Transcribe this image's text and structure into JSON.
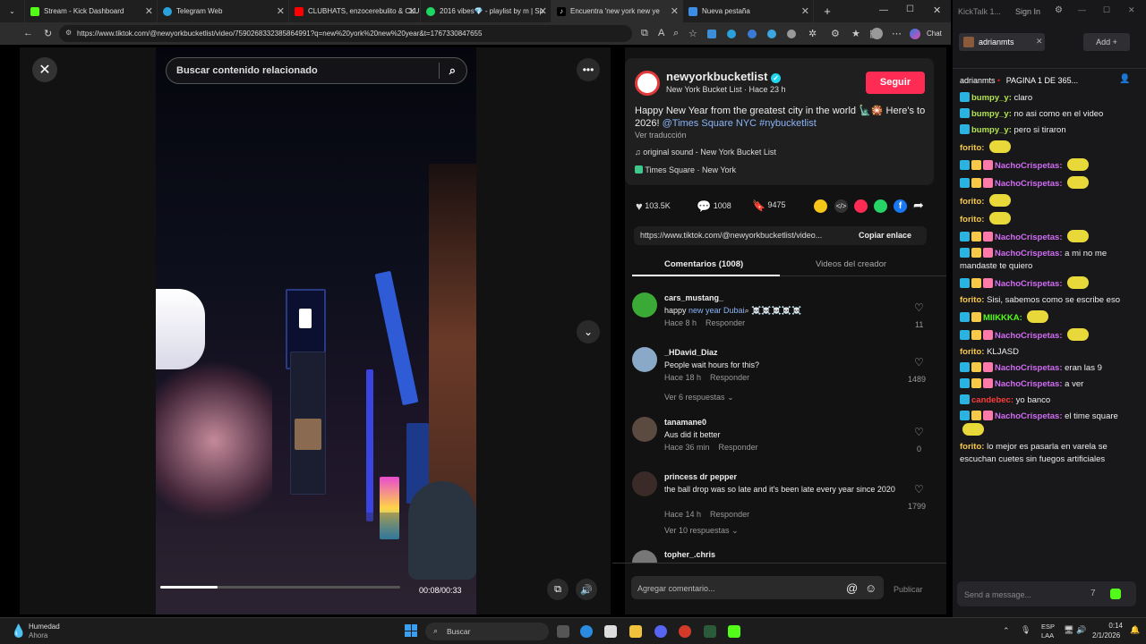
{
  "tabs": [
    {
      "label": "Stream - Kick Dashboard",
      "color": "#53fc18"
    },
    {
      "label": "Telegram Web",
      "color": "#2aa1da"
    },
    {
      "label": "CLUBHATS, enzocerebulito & CLU",
      "color": "#ff0000"
    },
    {
      "label": "2016 vibes💎 - playlist by m | Sp",
      "color": "#1ed760"
    },
    {
      "label": "Encuentra 'new york new ye",
      "color": "#ffffff"
    },
    {
      "label": "Nueva pestaña",
      "color": "#3a8ee6"
    }
  ],
  "address": {
    "url": "https://www.tiktok.com/@newyorkbucketlist/video/7590268332385864991?q=new%20york%20new%20year&t=1767330847655",
    "chat_label": "Chat"
  },
  "video": {
    "search_placeholder": "Buscar contenido relacionado",
    "time": "00:08/00:33",
    "progress": 0.24
  },
  "post": {
    "username": "newyorkbucketlist",
    "subtitle": "New York Bucket List · Hace 23 h",
    "follow": "Seguir",
    "caption": "Happy New Year from the greatest city in the world 🗽🎇 Here's to 2026!",
    "mention": "@Times Square NYC",
    "hashtag": "#nybucketlist",
    "translate": "Ver traducción",
    "sound": "original sound - New York Bucket List",
    "location": "Times Square · New York",
    "likes": "103.5K",
    "comments": "1008",
    "saves": "9475",
    "link": "https://www.tiktok.com/@newyorkbucketlist/video...",
    "copy": "Copiar enlace"
  },
  "tabs2": {
    "comments": "Comentarios (1008)",
    "creator": "Videos del creador"
  },
  "comments": [
    {
      "user": "cars_mustang_",
      "text_a": "happy ",
      "text_b": "new year Dubai",
      "text_c": "⌕ ☠️☠️☠️☠️☠️",
      "time": "Hace 8 h",
      "reply": "Responder",
      "likes": "11",
      "color": "#3aa935"
    },
    {
      "user": "_HDavid_Diaz",
      "text": "People wait hours for this?",
      "time": "Hace 18 h",
      "reply": "Responder",
      "likes": "1489",
      "more": "Ver 6 respuestas",
      "color": "#8aa8c8"
    },
    {
      "user": "tanamane0",
      "text": "Aus did it better",
      "time": "Hace 36 min",
      "reply": "Responder",
      "likes": "0",
      "color": "#5a4a40"
    },
    {
      "user": "princess dr pepper",
      "text": "the ball drop was so late and it's been late every year since 2020",
      "time": "Hace 14 h",
      "reply": "Responder",
      "likes": "1799",
      "more": "Ver 10 respuestas",
      "color": "#3a2a28"
    },
    {
      "user": "topher_.chris",
      "color": "#777"
    }
  ],
  "comment_input": {
    "placeholder": "Agregar comentario...",
    "publish": "Publicar"
  },
  "kick": {
    "app": "KickTalk 1...",
    "signin": "Sign In",
    "channel": "adrianmts",
    "add": "Add",
    "header_user": "adrianmts",
    "page": "PAGINA 1 DE 365...",
    "send_placeholder": "Send a message..."
  },
  "chat": [
    {
      "user": "bumpy_y:",
      "msg": "claro",
      "ucolor": "#b4e34c",
      "badges": 1
    },
    {
      "user": "bumpy_y:",
      "msg": "no asi como en el video",
      "ucolor": "#b4e34c",
      "badges": 1
    },
    {
      "user": "bumpy_y:",
      "msg": "pero si tiraron",
      "ucolor": "#b4e34c",
      "badges": 1
    },
    {
      "user": "forito:",
      "msg": "",
      "ucolor": "#f7c948",
      "badges": 0,
      "emote": true
    },
    {
      "user": "NachoCrispetas:",
      "msg": "",
      "ucolor": "#d16cf2",
      "badges": 3,
      "emote": true
    },
    {
      "user": "NachoCrispetas:",
      "msg": "",
      "ucolor": "#d16cf2",
      "badges": 3,
      "emote": true
    },
    {
      "user": "forito:",
      "msg": "",
      "ucolor": "#f7c948",
      "badges": 0,
      "emote": true
    },
    {
      "user": "forito:",
      "msg": "",
      "ucolor": "#f7c948",
      "badges": 0,
      "emote": true
    },
    {
      "user": "NachoCrispetas:",
      "msg": "",
      "ucolor": "#d16cf2",
      "badges": 3,
      "emote": true
    },
    {
      "user": "NachoCrispetas:",
      "msg": "a mi no me mandaste te quiero",
      "ucolor": "#d16cf2",
      "badges": 3
    },
    {
      "user": "NachoCrispetas:",
      "msg": "",
      "ucolor": "#d16cf2",
      "badges": 3,
      "emote": true
    },
    {
      "user": "forito:",
      "msg": "Sisi, sabemos como se escribe eso",
      "ucolor": "#f7c948",
      "badges": 0
    },
    {
      "user": "MIIKKKA:",
      "msg": "",
      "ucolor": "#53fc18",
      "badges": 2,
      "emote": true
    },
    {
      "user": "NachoCrispetas:",
      "msg": "",
      "ucolor": "#d16cf2",
      "badges": 3,
      "emote": true
    },
    {
      "user": "forito:",
      "msg": "KLJASD",
      "ucolor": "#f7c948",
      "badges": 0
    },
    {
      "user": "NachoCrispetas:",
      "msg": "eran las 9",
      "ucolor": "#d16cf2",
      "badges": 3
    },
    {
      "user": "NachoCrispetas:",
      "msg": "a ver",
      "ucolor": "#d16cf2",
      "badges": 3
    },
    {
      "user": "candebec:",
      "msg": "yo banco",
      "ucolor": "#ff3b3b",
      "badges": 1
    },
    {
      "user": "NachoCrispetas:",
      "msg": "el time square",
      "ucolor": "#d16cf2",
      "badges": 3,
      "emote": true
    },
    {
      "user": "forito:",
      "msg": "lo mejor es pasarla en varela se escuchan cuetes sin fuegos artificiales",
      "ucolor": "#f7c948",
      "badges": 0
    }
  ],
  "taskbar": {
    "weather_title": "Humedad",
    "weather_sub": "Ahora",
    "search": "Buscar",
    "lang1": "ESP",
    "lang2": "LAA",
    "time": "0:14",
    "date": "2/1/2026"
  }
}
